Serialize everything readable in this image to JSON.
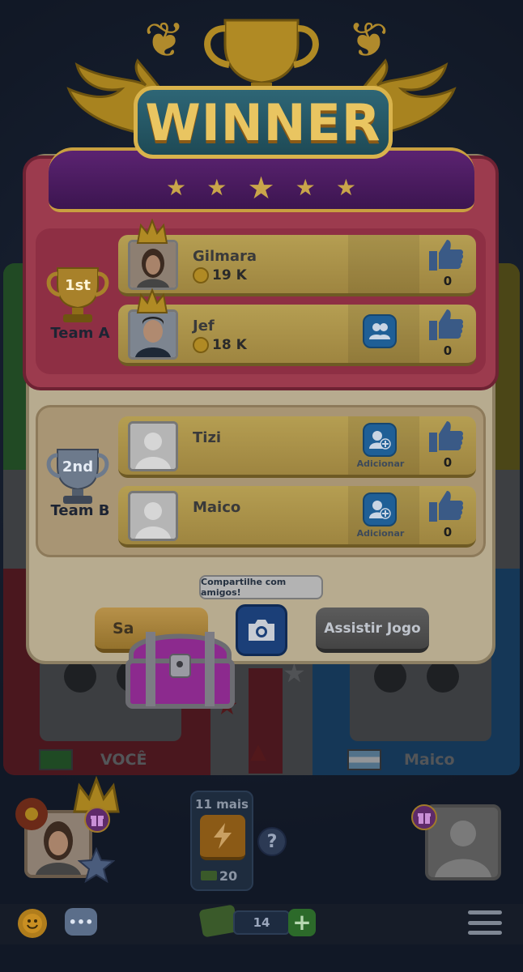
{
  "header": {
    "title": "WINNER"
  },
  "teams": [
    {
      "rank": "1st",
      "label": "Team A",
      "players": [
        {
          "name": "Gilmara",
          "coins": "19 K",
          "likes": "0",
          "crown": true
        },
        {
          "name": "Jef",
          "coins": "18 K",
          "likes": "0",
          "crown": true,
          "friend_action": ""
        }
      ]
    },
    {
      "rank": "2nd",
      "label": "Team B",
      "players": [
        {
          "name": "Tizi",
          "likes": "0",
          "add_label": "Adicionar"
        },
        {
          "name": "Maico",
          "likes": "0",
          "add_label": "Adicionar"
        }
      ]
    }
  ],
  "actions": {
    "share_tooltip": "Compartilhe com amigos!",
    "left_button": "Sa",
    "watch_button": "Assistir Jogo"
  },
  "board": {
    "self_name": "VOCÊ",
    "opponent_name": "Maico"
  },
  "bottom": {
    "boost_label": "11 mais",
    "boost_count": "20",
    "help": "?",
    "money": "14",
    "plus": "+"
  },
  "colors": {
    "accent_gold": "#d9b34c",
    "team1_bg": "#8e2f44",
    "team2_bg": "#a89574",
    "share_button": "#1b3f78"
  }
}
